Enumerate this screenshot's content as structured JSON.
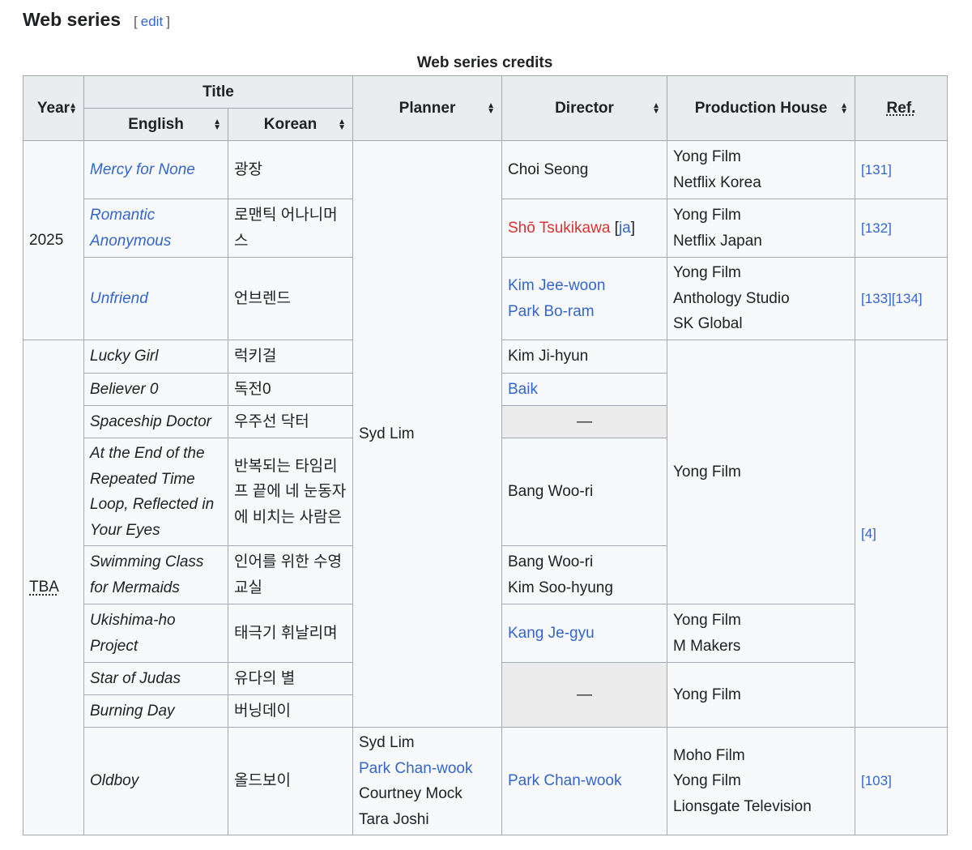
{
  "section": {
    "heading": "Web series",
    "edit_open": "[",
    "edit_label": "edit",
    "edit_close": "]"
  },
  "table": {
    "caption": "Web series credits",
    "headers": {
      "year": "Year",
      "title": "Title",
      "english": "English",
      "korean": "Korean",
      "planner": "Planner",
      "director": "Director",
      "production_house": "Production House",
      "ref": "Ref."
    },
    "sort_up": "▲",
    "sort_down": "▼",
    "years": {
      "y2025": "2025",
      "tba": "TBA"
    },
    "planner_shared": "Syd Lim",
    "dash": "—",
    "rows": [
      {
        "english": "Mercy for None",
        "korean": "광장",
        "director": [
          "Choi Seong"
        ],
        "production": [
          "Yong Film",
          "Netflix Korea"
        ],
        "ref": "[131]"
      },
      {
        "english": "Romantic Anonymous",
        "korean": "로맨틱 어나니머스",
        "director_name": "Shō Tsukikawa",
        "director_bracket_open": " [",
        "director_lang": "ja",
        "director_bracket_close": "]",
        "production": [
          "Yong Film",
          "Netflix Japan"
        ],
        "ref": "[132]"
      },
      {
        "english": "Unfriend",
        "korean": "언브렌드",
        "director": [
          "Kim Jee-woon",
          "Park Bo-ram"
        ],
        "production": [
          "Yong Film",
          "Anthology Studio",
          "SK Global"
        ],
        "ref": "[133][134]"
      },
      {
        "english": "Lucky Girl",
        "korean": "럭키걸",
        "director": [
          "Kim Ji-hyun"
        ]
      },
      {
        "english": "Believer 0",
        "korean": "독전0",
        "director": [
          "Baik"
        ]
      },
      {
        "english": "Spaceship Doctor",
        "korean": "우주선 닥터"
      },
      {
        "english": "At the End of the Repeated Time Loop, Reflected in Your Eyes",
        "korean": "반복되는 타임리프 끝에 네 눈동자에 비치는 사람은",
        "director": [
          "Bang Woo-ri"
        ]
      },
      {
        "english": "Swimming Class for Mermaids",
        "korean": "인어를 위한 수영교실",
        "director": [
          "Bang Woo-ri",
          "Kim Soo-hyung"
        ]
      },
      {
        "english": "Ukishima-ho Project",
        "korean": "태극기 휘날리며",
        "director": [
          "Kang Je-gyu"
        ],
        "production": [
          "Yong Film",
          "M Makers"
        ]
      },
      {
        "english": "Star of Judas",
        "korean": "유다의 별"
      },
      {
        "english": "Burning Day",
        "korean": "버닝데이"
      },
      {
        "english": "Oldboy",
        "korean": "올드보이",
        "planner": [
          "Syd Lim",
          "Park Chan-wook",
          "Courtney Mock",
          "Tara Joshi"
        ],
        "director": [
          "Park Chan-wook"
        ],
        "production": [
          "Moho Film",
          "Yong Film",
          "Lionsgate Television"
        ],
        "ref": "[103]"
      }
    ],
    "tba_production_shared": "Yong Film",
    "tba_production_shared_2": "Yong Film",
    "tba_ref_shared": "[4]"
  },
  "colors": {
    "link": "#3366cc",
    "redlink": "#d73333",
    "header_bg": "#eaecf0",
    "cell_bg": "#f8f9fa",
    "tba_bg": "#ddddff",
    "border": "#a2a9b1"
  }
}
